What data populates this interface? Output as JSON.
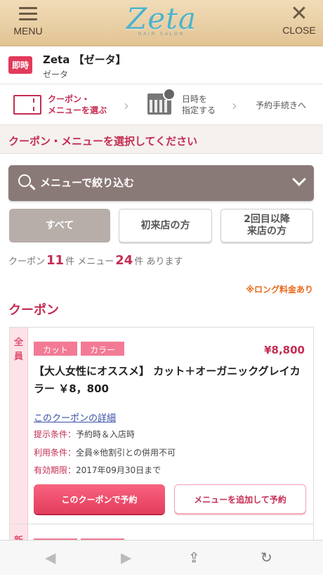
{
  "header": {
    "menu_label": "MENU",
    "close_label": "CLOSE",
    "logo_text": "Zeta",
    "logo_sub": "HAIR SALON"
  },
  "salon": {
    "badge": "即時",
    "name": "Zeta 【ゼータ】",
    "kana": "ゼータ"
  },
  "steps": {
    "step1_line1": "クーポン・",
    "step1_line2": "メニューを選ぶ",
    "step2_line1": "日時を",
    "step2_line2": "指定する",
    "step3": "予約手続きへ"
  },
  "select_heading": "クーポン・メニューを選択してください",
  "filter": {
    "label": "メニューで絞り込む"
  },
  "tabs": {
    "all": "すべて",
    "first_visit": "初来店の方",
    "repeat_line1": "2回目以降",
    "repeat_line2": "来店の方"
  },
  "counts": {
    "coupon_label": "クーポン",
    "coupon_count": "11",
    "unit1": "件",
    "menu_label": "メニュー",
    "menu_count": "24",
    "unit2": "件",
    "suffix": "あります"
  },
  "long_note": "※ロング料金あり",
  "coupon_section_title": "クーポン",
  "coupon": {
    "side_label": "全員",
    "tags": [
      "カット",
      "カラー"
    ],
    "price": "¥8,800",
    "title": "【大人女性にオススメ】 カット＋オーガニックグレイカラー ￥8，800",
    "detail_link": "このクーポンの詳細",
    "present_key": "提示条件：",
    "present_val": "予約時＆入店時",
    "usage_key": "利用条件：",
    "usage_val": "全員※他割引との併用不可",
    "expire_key": "有効期限：",
    "expire_val": "2017年09月30日まで",
    "reserve_btn": "このクーポンで予約",
    "add_btn": "メニューを追加して予約"
  },
  "coupon2": {
    "side_label": "新"
  },
  "browser": {
    "back_icon": "arrow-left-icon",
    "forward_icon": "arrow-right-icon",
    "share_icon": "share-icon",
    "reload_icon": "reload-icon"
  }
}
